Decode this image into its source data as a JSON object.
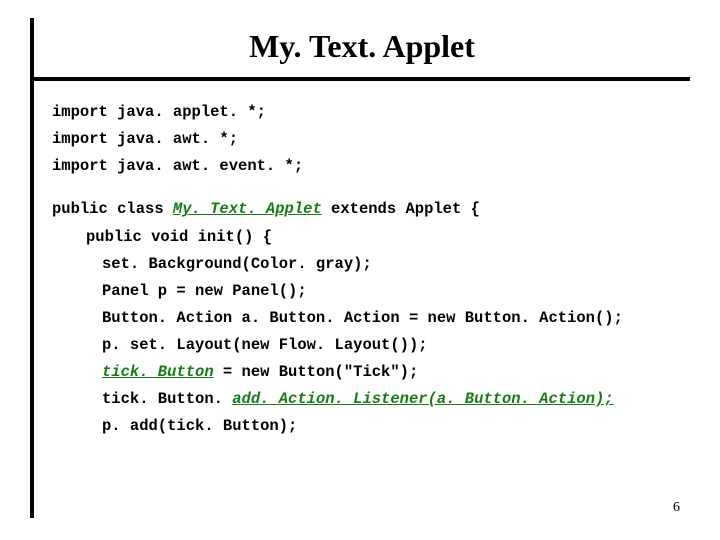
{
  "title": "My. Text. Applet",
  "code": {
    "l1": "import java. applet. *;",
    "l2": "import java. awt. *;",
    "l3": "import java. awt. event. *;",
    "l4a": "public class ",
    "l4b": "My. Text. Applet",
    "l4c": " extends Applet {",
    "l5": "public  void init()  {",
    "l6": "set. Background(Color. gray);",
    "l7": "Panel p = new Panel();",
    "l8": "Button. Action a. Button. Action = new Button. Action();",
    "l9": "p. set. Layout(new Flow. Layout());",
    "l10a": "tick. Button",
    "l10b": " = new Button(\"Tick\");",
    "l11a": "tick. Button. ",
    "l11b": "add. Action. Listener(a. Button. Action);",
    "l12": "p. add(tick. Button);"
  },
  "page_number": "6"
}
